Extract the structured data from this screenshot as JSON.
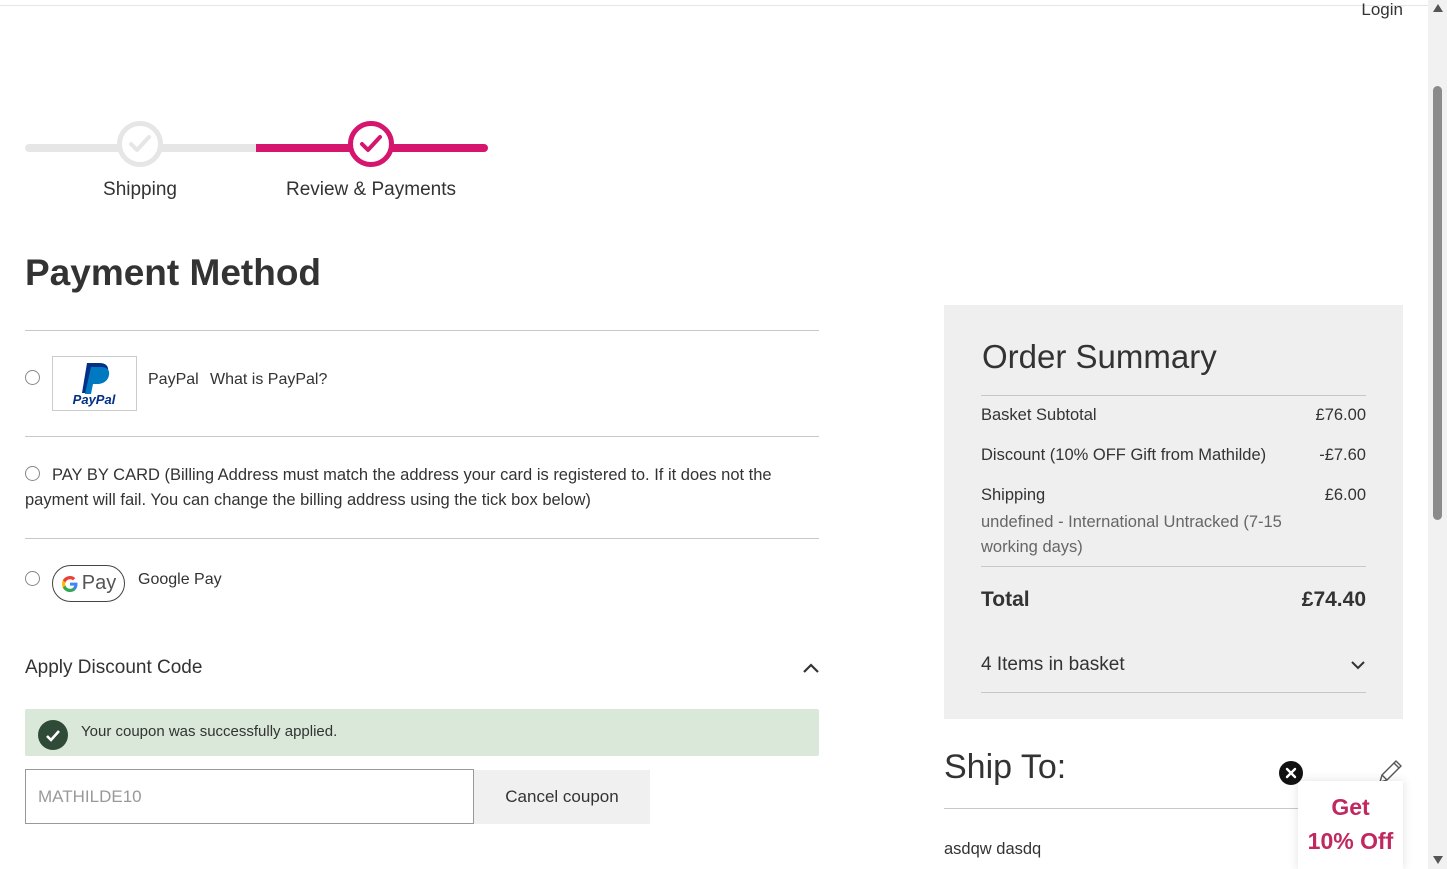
{
  "header": {
    "login_label": "Login"
  },
  "progress": {
    "steps": [
      {
        "label": "Shipping",
        "state": "complete",
        "icon": "check-icon"
      },
      {
        "label": "Review & Payments",
        "state": "current",
        "icon": "check-icon"
      }
    ],
    "active_color": "#d5156e"
  },
  "payment": {
    "title": "Payment Method",
    "methods": [
      {
        "id": "paypal",
        "logo_text": "PayPal",
        "label": "PayPal",
        "help_link": "What is PayPal?",
        "selected": false
      },
      {
        "id": "card",
        "label": "PAY BY CARD (Billing Address must match the address your card is registered to. If it does not the payment will fail. You can change the billing address using the tick box below)",
        "selected": false
      },
      {
        "id": "googlepay",
        "logo_text": "Pay",
        "label": "Google Pay",
        "selected": false
      }
    ]
  },
  "discount": {
    "title": "Apply Discount Code",
    "expanded": true,
    "success_message": "Your coupon was successfully applied.",
    "code_placeholder": "MATHILDE10",
    "cancel_label": "Cancel coupon",
    "success_color": "#d9e8d9"
  },
  "summary": {
    "title": "Order Summary",
    "subtotal_label": "Basket Subtotal",
    "subtotal_value": "£76.00",
    "discount_label": "Discount (10% OFF Gift from Mathilde)",
    "discount_value": "-£7.60",
    "shipping_label": "Shipping",
    "shipping_value": "£6.00",
    "shipping_method": "undefined - International Untracked (7-15 working days)",
    "total_label": "Total",
    "total_value": "£74.40",
    "items_label": "4 Items in basket"
  },
  "ship_to": {
    "title": "Ship To:",
    "name": "asdqw dasdq"
  },
  "promo_popup": {
    "line1": "Get",
    "line2": "10% Off",
    "color": "#c0285e"
  }
}
